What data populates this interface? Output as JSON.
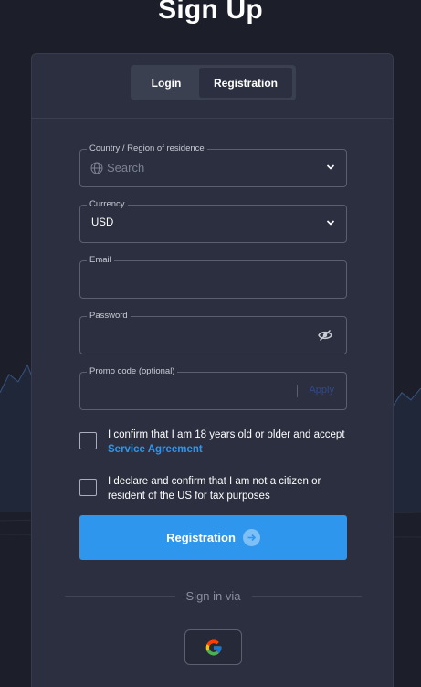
{
  "page": {
    "title": "Sign Up"
  },
  "tabs": [
    {
      "label": "Login",
      "active": false
    },
    {
      "label": "Registration",
      "active": true
    }
  ],
  "form": {
    "country": {
      "label": "Country / Region of residence",
      "placeholder": "Search",
      "icon": "globe-icon"
    },
    "currency": {
      "label": "Currency",
      "value": "USD"
    },
    "email": {
      "label": "Email",
      "value": ""
    },
    "password": {
      "label": "Password",
      "value": "",
      "icon": "eye-off-icon"
    },
    "promo": {
      "label": "Promo code (optional)",
      "value": "",
      "apply_label": "Apply"
    }
  },
  "checks": [
    {
      "text": "I confirm that I am 18 years old or older and accept",
      "link": "Service Agreement",
      "checked": false
    },
    {
      "text": "I declare and confirm that I am not a citizen or resident of the US for tax purposes",
      "checked": false
    }
  ],
  "submit": {
    "label": "Registration",
    "icon": "arrow-right-icon"
  },
  "social": {
    "label": "Sign in via",
    "providers": [
      "google"
    ]
  },
  "colors": {
    "accent": "#2f96ee",
    "background": "#1c1f29",
    "card": "#2b2f3f"
  }
}
